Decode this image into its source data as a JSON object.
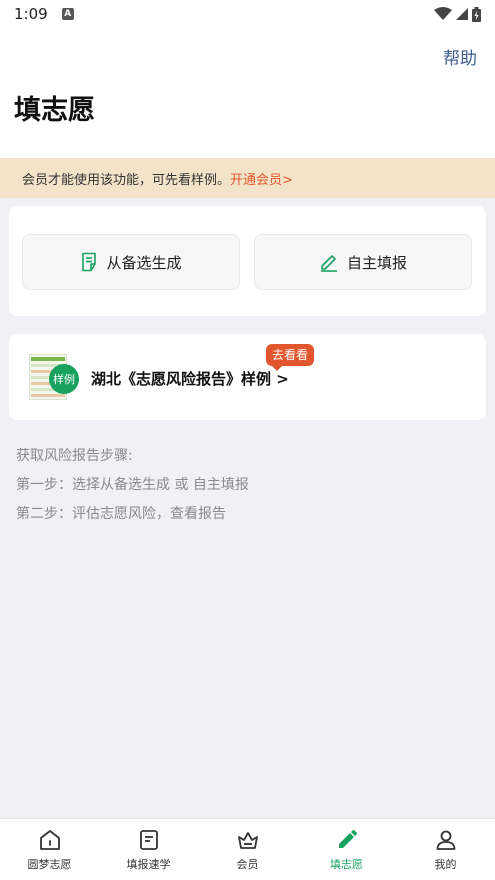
{
  "status_bar": {
    "time": "1:09",
    "notif_icon": "A"
  },
  "header": {
    "help": "帮助",
    "title": "填志愿"
  },
  "member_banner": {
    "text": "会员才能使用该功能，可先看样例。",
    "link": "开通会员>"
  },
  "actions": [
    {
      "label": "从备选生成",
      "icon": "document-list-icon"
    },
    {
      "label": "自主填报",
      "icon": "pencil-icon"
    }
  ],
  "sample": {
    "badge": "样例",
    "text": "湖北《志愿风险报告》样例 >",
    "tag": "去看看"
  },
  "steps": {
    "title": "获取风险报告步骤:",
    "step1": "第一步：选择从备选生成 或 自主填报",
    "step2": "第二步：评估志愿风险，查看报告"
  },
  "tabs": [
    {
      "label": "圆梦志愿",
      "icon": "home-icon"
    },
    {
      "label": "填报速学",
      "icon": "book-icon"
    },
    {
      "label": "会员",
      "icon": "crown-icon"
    },
    {
      "label": "填志愿",
      "icon": "pencil-icon",
      "active": true
    },
    {
      "label": "我的",
      "icon": "person-icon"
    }
  ],
  "colors": {
    "accent": "#19a15f",
    "link": "#e2562d",
    "help": "#3e5c8f",
    "banner": "#f3e4c9"
  }
}
